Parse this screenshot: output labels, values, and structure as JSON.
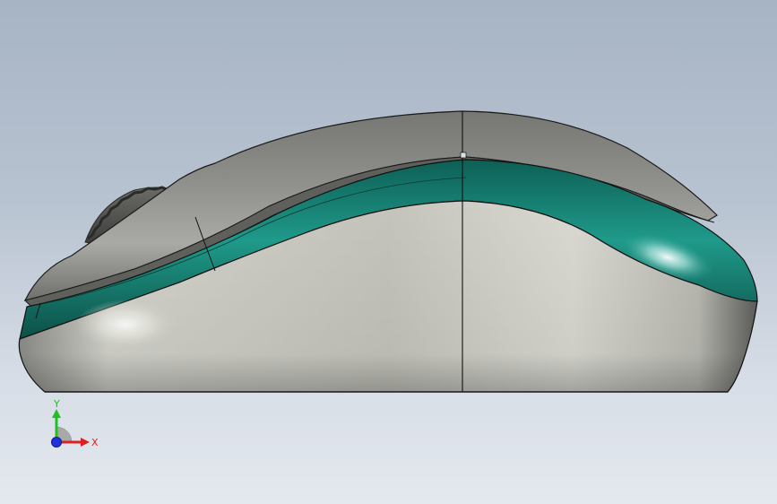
{
  "viewport": {
    "background_top": "#a7b4c4",
    "background_bottom": "#e4e9ef"
  },
  "model": {
    "shell_color": "#9a9b97",
    "accent_color": "#1f9a8a",
    "base_color": "#d6d6cf",
    "edge_color": "#111111"
  },
  "triad": {
    "x_label": "X",
    "y_label": "Y",
    "x_color": "#e02020",
    "y_color": "#20c020",
    "z_color": "#2030e0"
  }
}
